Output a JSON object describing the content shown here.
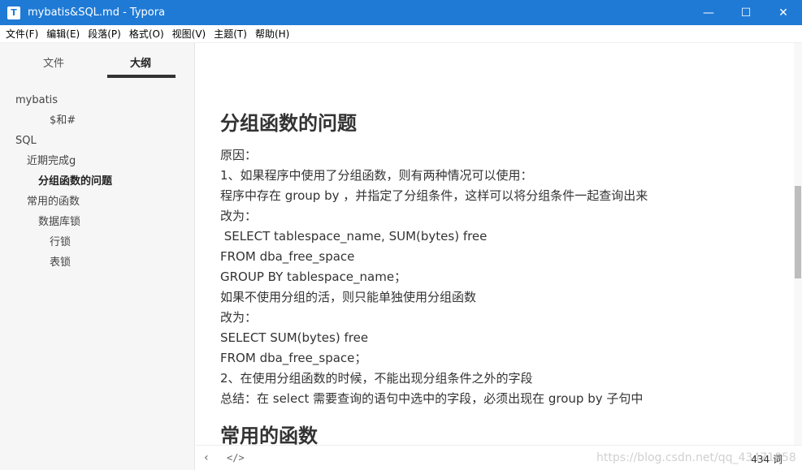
{
  "window": {
    "app_icon": "T",
    "title": "mybatis&SQL.md - Typora",
    "controls": {
      "minimize": "—",
      "maximize": "☐",
      "close": "✕"
    }
  },
  "menu": [
    "文件(F)",
    "编辑(E)",
    "段落(P)",
    "格式(O)",
    "视图(V)",
    "主题(T)",
    "帮助(H)"
  ],
  "sidebar": {
    "tabs": {
      "files": "文件",
      "outline": "大纲"
    },
    "outline": [
      {
        "label": "mybatis",
        "level": 1
      },
      {
        "label": "$和#",
        "level": 3
      },
      {
        "label": "SQL",
        "level": 1
      },
      {
        "label": "近期完成g",
        "level": 2
      },
      {
        "label": "分组函数的问题",
        "level": 3,
        "active": true
      },
      {
        "label": "常用的函数",
        "level": 2
      },
      {
        "label": "数据库锁",
        "level": 3
      },
      {
        "label": "行锁",
        "level": 4
      },
      {
        "label": "表锁",
        "level": 4
      }
    ]
  },
  "document": {
    "heading": "分组函数的问题",
    "lines": [
      "原因：",
      "1、如果程序中使用了分组函数，则有两种情况可以使用：",
      "程序中存在 group by ，并指定了分组条件，这样可以将分组条件一起查询出来",
      "改为：",
      " SELECT tablespace_name, SUM(bytes) free",
      "FROM dba_free_space",
      "GROUP BY tablespace_name；",
      "如果不使用分组的活，则只能单独使用分组函数",
      "改为：",
      "SELECT SUM(bytes) free",
      "FROM dba_free_space；",
      "2、在使用分组函数的时候，不能出现分组条件之外的字段",
      "总结：在 select 需要查询的语句中选中的字段，必须出现在 group by 子句中"
    ],
    "next_heading": "常用的函数"
  },
  "status": {
    "back_icon": "back-chevron-icon",
    "back_glyph": "‹",
    "code_glyph": "</>",
    "watermark": "https://blog.csdn.net/qq_43471858",
    "word_count": "434 词"
  }
}
